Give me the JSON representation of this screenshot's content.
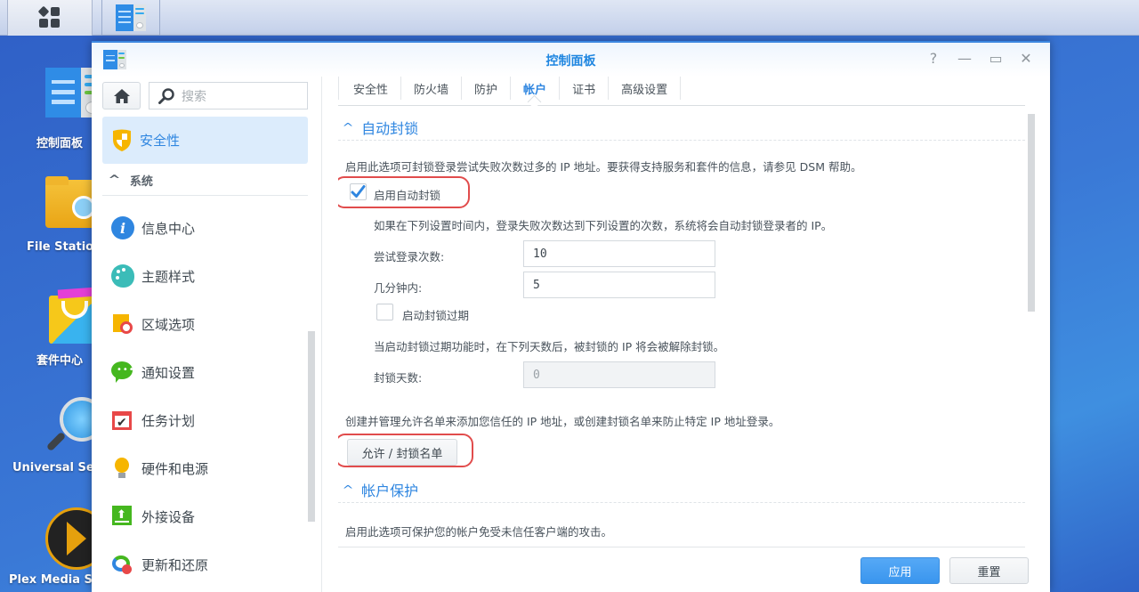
{
  "taskbar": {
    "main_menu_icon": "grid-icon",
    "open_app_icon": "control-panel-icon"
  },
  "desktop": {
    "icons": [
      {
        "label": "控制面板",
        "icon": "control-panel-icon"
      },
      {
        "label": "File Station",
        "icon": "folder-search-icon"
      },
      {
        "label": "套件中心",
        "icon": "package-center-icon"
      },
      {
        "label": "Universal Search",
        "icon": "radar-magnifier-icon"
      },
      {
        "label": "Plex Media Server",
        "icon": "plex-icon"
      }
    ]
  },
  "window": {
    "title": "控制面板",
    "controls": {
      "help": "?",
      "minimize": "—",
      "maximize": "▭",
      "close": "✕"
    }
  },
  "sidebar": {
    "search_placeholder": "搜索",
    "active_item": {
      "label": "安全性",
      "icon": "shield-icon"
    },
    "group_label": "系统",
    "items": [
      {
        "label": "信息中心",
        "icon": "info-icon"
      },
      {
        "label": "主题样式",
        "icon": "palette-icon"
      },
      {
        "label": "区域选项",
        "icon": "map-clock-icon"
      },
      {
        "label": "通知设置",
        "icon": "chat-bubble-icon"
      },
      {
        "label": "任务计划",
        "icon": "calendar-check-icon"
      },
      {
        "label": "硬件和电源",
        "icon": "lightbulb-icon"
      },
      {
        "label": "外接设备",
        "icon": "external-device-icon"
      },
      {
        "label": "更新和还原",
        "icon": "update-restore-icon"
      }
    ]
  },
  "tabs": [
    {
      "label": "安全性",
      "active": false
    },
    {
      "label": "防火墙",
      "active": false
    },
    {
      "label": "防护",
      "active": false
    },
    {
      "label": "帐户",
      "active": true
    },
    {
      "label": "证书",
      "active": false
    },
    {
      "label": "高级设置",
      "active": false
    }
  ],
  "auto_block": {
    "section_title": "自动封锁",
    "description": "启用此选项可封锁登录尝试失败次数过多的 IP 地址。要获得支持服务和套件的信息，请参见 DSM 帮助。",
    "enable_label": "启用自动封锁",
    "enable_checked": true,
    "rule_description": "如果在下列设置时间内，登录失败次数达到下列设置的次数，系统将会自动封锁登录者的 IP。",
    "attempts_label": "尝试登录次数:",
    "attempts_value": "10",
    "minutes_label": "几分钟内:",
    "minutes_value": "5",
    "expire_label": "启动封锁过期",
    "expire_checked": false,
    "expire_description": "当启动封锁过期功能时，在下列天数后，被封锁的 IP 将会被解除封锁。",
    "days_label": "封锁天数:",
    "days_value": "0",
    "list_description": "创建并管理允许名单来添加您信任的 IP 地址，或创建封锁名单来防止特定 IP 地址登录。",
    "list_button": "允许 / 封锁名单"
  },
  "account_protection": {
    "section_title": "帐户保护",
    "description": "启用此选项可保护您的帐户免受未信任客户端的攻击。"
  },
  "footer": {
    "apply": "应用",
    "reset": "重置"
  },
  "colors": {
    "accent": "#2f86e0",
    "highlight_ring": "#e14c4c",
    "active_sidebar_bg": "#dcecfc"
  }
}
